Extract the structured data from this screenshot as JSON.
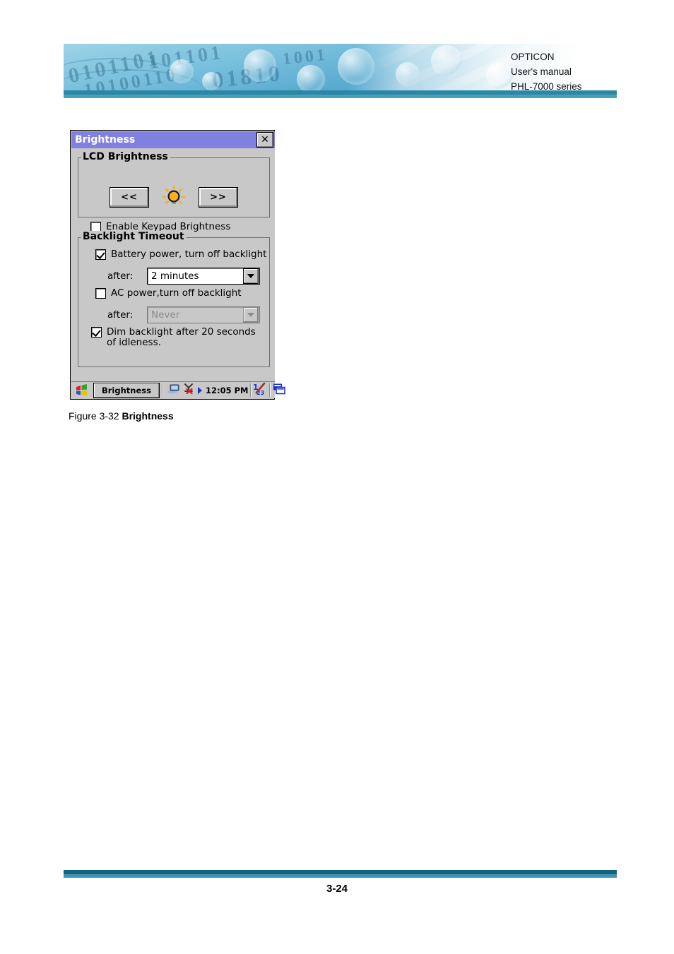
{
  "header": {
    "company": "OPTICON",
    "doc_type": "User's manual",
    "product": "PHL-7000 series",
    "banner_accent": "#2b87a6"
  },
  "dialog": {
    "title": "Brightness",
    "close_label": "✕",
    "titlebar_color": "#8080e0",
    "face_color": "#c8c8c8",
    "lcd_group": {
      "legend": "LCD Brightness",
      "decrease_label": "<<",
      "increase_label": ">>",
      "lamp_color": "#f5b21a"
    },
    "keypad": {
      "label": "Enable Keypad Brightness",
      "checked": false
    },
    "backlight_group": {
      "legend": "Backlight Timeout",
      "battery": {
        "label": "Battery power, turn off backlight",
        "checked": true,
        "after_label": "after:",
        "value": "2 minutes",
        "enabled": true
      },
      "ac": {
        "label": "AC  power,turn off backlight",
        "checked": false,
        "after_label": "after:",
        "value": "Never",
        "enabled": false
      },
      "dim": {
        "label": "Dim backlight after 20 seconds of idleness.",
        "checked": true
      }
    },
    "taskbar": {
      "start_icon": "windows-start-icon",
      "task_label": "Brightness",
      "tray_icons": [
        "desktop-connection-icon",
        "disconnected-network-icon",
        "play-arrow-icon"
      ],
      "clock": "12:05 PM",
      "tray_icons_right": [
        "input-panel-icon",
        "window-switch-icon"
      ]
    }
  },
  "figure": {
    "prefix": "Figure 3-32 ",
    "name": "Brightness"
  },
  "footer": {
    "page_number": "3-24"
  }
}
